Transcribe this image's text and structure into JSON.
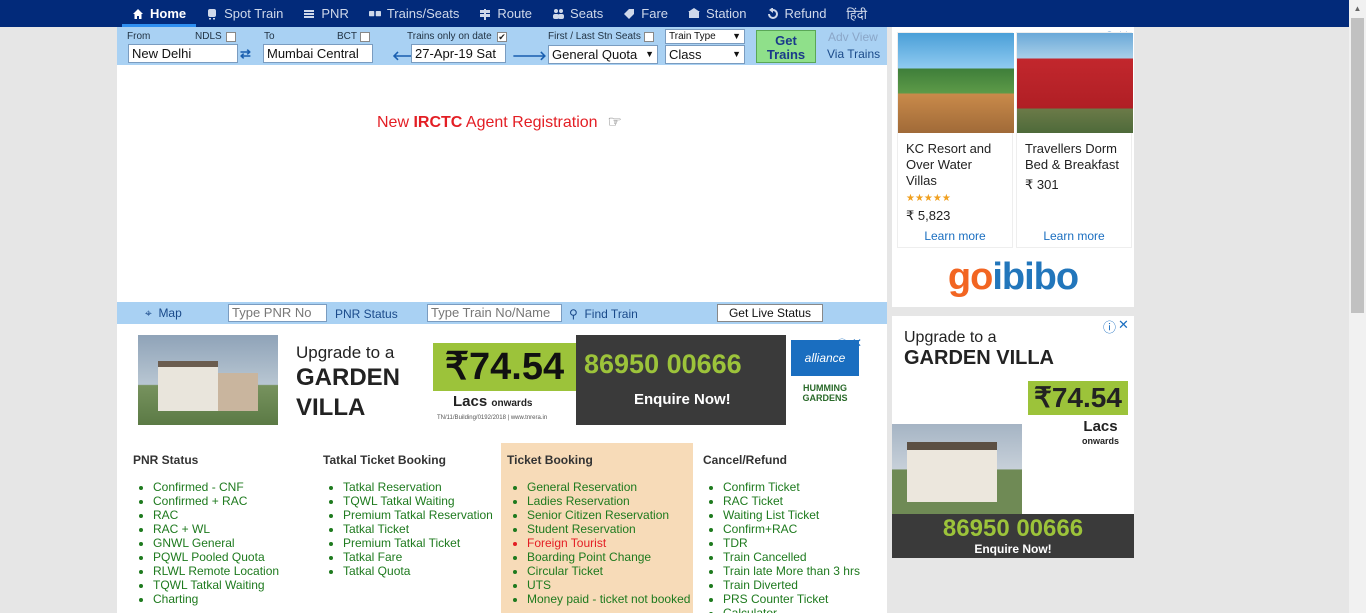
{
  "nav": [
    {
      "label": "Home",
      "icon": "home-icon",
      "active": true
    },
    {
      "label": "Spot Train",
      "icon": "train-icon"
    },
    {
      "label": "PNR",
      "icon": "list-icon"
    },
    {
      "label": "Trains/Seats",
      "icon": "coach-icon"
    },
    {
      "label": "Route",
      "icon": "signpost-icon"
    },
    {
      "label": "Seats",
      "icon": "people-icon"
    },
    {
      "label": "Fare",
      "icon": "tag-icon"
    },
    {
      "label": "Station",
      "icon": "station-icon"
    },
    {
      "label": "Refund",
      "icon": "refund-icon"
    },
    {
      "label": "हिंदी",
      "icon": ""
    }
  ],
  "search": {
    "from_label": "From",
    "from_code": "NDLS",
    "from_value": "New Delhi",
    "to_label": "To",
    "to_code": "BCT",
    "to_value": "Mumbai Central",
    "date_label": "Trains only on date",
    "date_value": "27-Apr-19 Sat",
    "date_checked": "✔",
    "first_last_label": "First / Last Stn Seats",
    "quota_value": "General Quota",
    "train_type_value": "Train Type",
    "class_value": "Class",
    "get_trains_line1": "Get",
    "get_trains_line2": "Trains",
    "adv_view": "Adv View",
    "via_trains": "Via Trains"
  },
  "promo": {
    "prefix": "New ",
    "brand": "IRCTC",
    "suffix": " Agent Registration",
    "hand": "☞"
  },
  "strip": {
    "map": "Map",
    "pnr_placeholder": "Type PNR No",
    "pnr_status": "PNR Status",
    "train_placeholder": "Type Train No/Name",
    "find_train": "Find Train",
    "live_status": "Get Live Status"
  },
  "banner": {
    "upgrade": "Upgrade to a",
    "garden": "GARDEN",
    "villa": "VILLA",
    "price": "₹74.54",
    "lacs": "Lacs",
    "onwards": "onwards",
    "reg": "TN/11/Building/0192/2018 | www.tnrera.in",
    "phone": "86950 00666",
    "enquire": "Enquire Now!",
    "alliance": "alliance",
    "hg1": "HUMMING",
    "hg2": "GARDENS"
  },
  "columns": [
    {
      "title": "PNR Status",
      "items": [
        {
          "text": "Confirmed - CNF"
        },
        {
          "text": "Confirmed + RAC"
        },
        {
          "text": "RAC"
        },
        {
          "text": "RAC + WL"
        },
        {
          "text": "GNWL General"
        },
        {
          "text": "PQWL Pooled Quota"
        },
        {
          "text": "RLWL Remote Location"
        },
        {
          "text": "TQWL Tatkal Waiting"
        },
        {
          "text": "Charting"
        }
      ]
    },
    {
      "title": "Tatkal Ticket Booking",
      "items": [
        {
          "text": "Tatkal Reservation"
        },
        {
          "text": "TQWL Tatkal Waiting"
        },
        {
          "text": "Premium Tatkal Reservation"
        },
        {
          "text": "Tatkal Ticket"
        },
        {
          "text": "Premium Tatkal Ticket"
        },
        {
          "text": "Tatkal Fare"
        },
        {
          "text": "Tatkal Quota"
        }
      ]
    },
    {
      "title": "Ticket Booking",
      "items": [
        {
          "text": "General Reservation"
        },
        {
          "text": "Ladies Reservation"
        },
        {
          "text": "Senior Citizen Reservation"
        },
        {
          "text": "Student Reservation"
        },
        {
          "text": "Foreign Tourist",
          "red": true
        },
        {
          "text": "Boarding Point Change"
        },
        {
          "text": "Circular Ticket"
        },
        {
          "text": "UTS"
        },
        {
          "text": "Money paid - ticket not booked"
        }
      ]
    },
    {
      "title": "Cancel/Refund",
      "items": [
        {
          "text": "Confirm Ticket"
        },
        {
          "text": "RAC Ticket"
        },
        {
          "text": "Waiting List Ticket"
        },
        {
          "text": "Confirm+RAC"
        },
        {
          "text": "TDR"
        },
        {
          "text": "Train Cancelled"
        },
        {
          "text": "Train late More than 3 hrs"
        },
        {
          "text": "Train Diverted"
        },
        {
          "text": "PRS Counter Ticket"
        },
        {
          "text": "Calculator"
        }
      ]
    }
  ],
  "hotels": [
    {
      "name": "KC Resort and Over Water Villas",
      "stars": "★★★★★",
      "price": "₹ 5,823",
      "cta": "Learn more"
    },
    {
      "name": "Travellers Dorm Bed & Breakfast",
      "stars": "",
      "price": "₹ 301",
      "cta": "Learn more"
    }
  ],
  "goibibo": {
    "g": "go",
    "rest": "ibibo"
  },
  "tall_ad": {
    "upgrade": "Upgrade to a",
    "villa": "GARDEN VILLA",
    "price": "₹74.54",
    "lacs": "Lacs",
    "onwards": "onwards",
    "phone": "86950 00666",
    "enquire": "Enquire Now!"
  },
  "colors": {
    "nav_bg": "#022a7a",
    "bar_bg": "#a9d1f3",
    "link_green": "#1e7a1e",
    "promo_red": "#e31e24"
  }
}
